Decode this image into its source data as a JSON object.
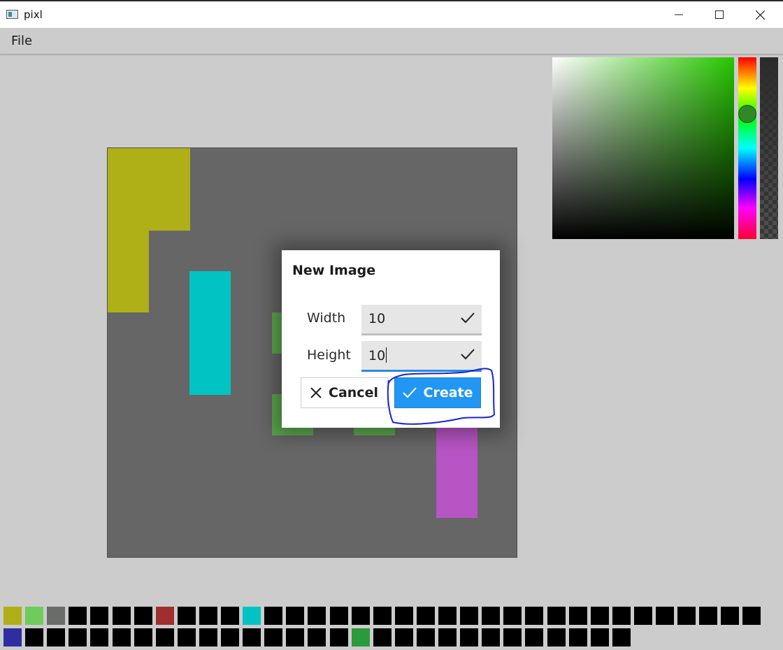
{
  "window": {
    "title": "pixl",
    "minimize_icon": "minimize-icon",
    "maximize_icon": "maximize-icon",
    "close_icon": "close-icon"
  },
  "menu": {
    "file_label": "File"
  },
  "canvas": {
    "background": "#666666",
    "grid_size": 10,
    "pixels": [
      {
        "col": 0,
        "row": 0,
        "color": "#afaf17"
      },
      {
        "col": 1,
        "row": 0,
        "color": "#afaf17"
      },
      {
        "col": 0,
        "row": 1,
        "color": "#afaf17"
      },
      {
        "col": 1,
        "row": 1,
        "color": "#afaf17"
      },
      {
        "col": 0,
        "row": 2,
        "color": "#afaf17"
      },
      {
        "col": 0,
        "row": 3,
        "color": "#afaf17"
      },
      {
        "col": 2,
        "row": 3,
        "color": "#02c3c3"
      },
      {
        "col": 2,
        "row": 4,
        "color": "#02c3c3"
      },
      {
        "col": 2,
        "row": 5,
        "color": "#02c3c3"
      },
      {
        "col": 4,
        "row": 4,
        "color": "#5ba84e"
      },
      {
        "col": 4,
        "row": 6,
        "color": "#5ba84e"
      },
      {
        "col": 6,
        "row": 6,
        "color": "#5ba84e"
      },
      {
        "col": 8,
        "row": 6,
        "color": "#b855c4"
      },
      {
        "col": 8,
        "row": 7,
        "color": "#b855c4"
      },
      {
        "col": 8,
        "row": 8,
        "color": "#b855c4"
      }
    ]
  },
  "color_picker": {
    "hue_color": "#26c600",
    "handle_color": "#2f8a26"
  },
  "dialog": {
    "title": "New Image",
    "width_label": "Width",
    "width_value": "10",
    "height_label": "Height",
    "height_value": "10",
    "cancel_label": "Cancel",
    "create_label": "Create",
    "accent": "#2196f3"
  },
  "palette": {
    "row1": [
      "#afaf17",
      "#6ecc5c",
      "#6a6c69",
      "#000000",
      "#000000",
      "#000000",
      "#000000",
      "#9f2f2f",
      "#000000",
      "#000000",
      "#000000",
      "#02c3c3",
      "#000000",
      "#000000",
      "#000000",
      "#000000",
      "#000000",
      "#000000",
      "#000000",
      "#000000",
      "#000000",
      "#000000",
      "#000000",
      "#000000",
      "#000000",
      "#000000",
      "#000000",
      "#000000",
      "#000000",
      "#000000",
      "#000000",
      "#000000",
      "#000000",
      "#000000",
      "#000000"
    ],
    "row2": [
      "#2e2ea0",
      "#000000",
      "#000000",
      "#000000",
      "#000000",
      "#000000",
      "#000000",
      "#000000",
      "#000000",
      "#000000",
      "#000000",
      "#000000",
      "#000000",
      "#000000",
      "#000000",
      "#000000",
      "#2a9a3a",
      "#000000",
      "#000000",
      "#000000",
      "#000000",
      "#000000",
      "#000000",
      "#000000",
      "#000000",
      "#000000",
      "#000000",
      "#000000",
      "#000000"
    ]
  }
}
